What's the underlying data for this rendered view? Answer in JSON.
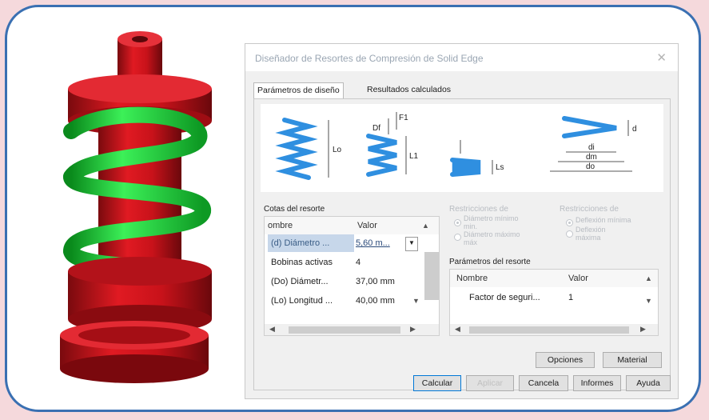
{
  "dialog": {
    "title": "Diseñador de Resortes de Compresión de Solid Edge",
    "close_glyph": "✕",
    "tabs": [
      {
        "label": "Parámetros de diseño",
        "active": true
      },
      {
        "label": "Resultados calculados",
        "active": false
      }
    ],
    "diagram_labels": {
      "lo": "Lo",
      "df": "Df",
      "f1": "F1",
      "l1": "L1",
      "ls": "Ls",
      "d": "d",
      "di": "di",
      "dm": "dm",
      "do": "do"
    },
    "cotas": {
      "title": "Cotas del resorte",
      "columns": [
        "ombre",
        "Valor"
      ],
      "rows": [
        {
          "name": "(d) Diámetro ...",
          "value": "5,60 m..."
        },
        {
          "name": "Bobinas activas",
          "value": "4"
        },
        {
          "name": "(Do) Diámetr...",
          "value": "37,00 mm"
        },
        {
          "name": "(Lo) Longitud ...",
          "value": "40,00 mm"
        }
      ]
    },
    "restricciones_1": {
      "title": "Restricciones de",
      "options": [
        "Diámetro mínimo",
        "min.",
        "Diámetro máximo",
        "máx"
      ]
    },
    "restricciones_2": {
      "title": "Restricciones de",
      "options": [
        "Deflexión mínima",
        "Deflexión",
        "máxima"
      ]
    },
    "parametros": {
      "title": "Parámetros del resorte",
      "columns": [
        "Nombre",
        "Valor"
      ],
      "rows": [
        {
          "name": "Factor de seguri...",
          "value": "1"
        }
      ]
    },
    "buttons": {
      "opciones": "Opciones",
      "material": "Material",
      "calcular": "Calcular",
      "aplicar": "Aplicar",
      "cancela": "Cancela",
      "informes": "Informes",
      "ayuda": "Ayuda"
    }
  },
  "colors": {
    "spring_green": "#19d23a",
    "body_red": "#d8141c",
    "frame_blue": "#3a70b2",
    "diagram_blue": "#2f8fe0",
    "background_pink": "#f5d9dc"
  }
}
